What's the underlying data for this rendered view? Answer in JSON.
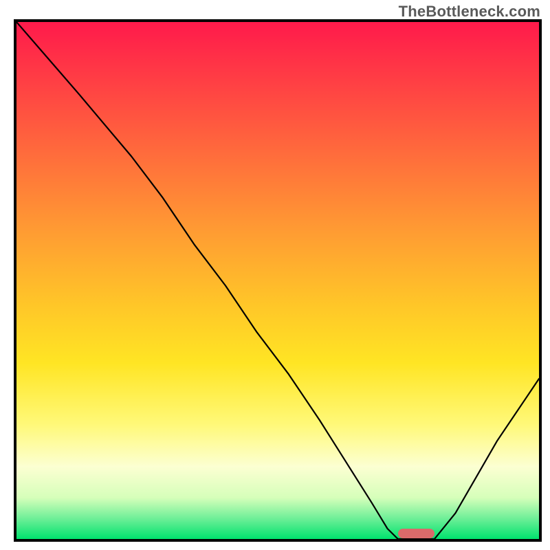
{
  "watermark": {
    "text": "TheBottleneck.com"
  },
  "chart_data": {
    "type": "line",
    "title": "",
    "xlabel": "",
    "ylabel": "",
    "xlim": [
      0,
      100
    ],
    "ylim": [
      0,
      100
    ],
    "grid": false,
    "legend": false,
    "note": "Bottleneck curve: y estimated as percent of plot height (100 = top, 0 = bottom). Curve descends from top-left, hits zero near x≈73, stays flat to x≈80, rises toward right.",
    "series": [
      {
        "name": "bottleneck-curve",
        "x": [
          0,
          6,
          12,
          17,
          22,
          28,
          34,
          40,
          46,
          52,
          58,
          63,
          68,
          71,
          73,
          76,
          80,
          84,
          88,
          92,
          96,
          100
        ],
        "y": [
          100,
          93,
          86,
          80,
          74,
          66,
          57,
          49,
          40,
          32,
          23,
          15,
          7,
          2,
          0,
          0,
          0,
          5,
          12,
          19,
          25,
          31
        ]
      }
    ],
    "marker": {
      "name": "optimal-zone",
      "x_start": 73,
      "x_end": 80,
      "y": 0,
      "color": "#da6a6a"
    },
    "background": {
      "type": "vertical-gradient",
      "stops": [
        {
          "pct": 0,
          "color": "#ff1a4b"
        },
        {
          "pct": 25,
          "color": "#ff6a3c"
        },
        {
          "pct": 55,
          "color": "#ffc728"
        },
        {
          "pct": 78,
          "color": "#fff97a"
        },
        {
          "pct": 92,
          "color": "#d6ffba"
        },
        {
          "pct": 100,
          "color": "#00e26e"
        }
      ]
    }
  }
}
